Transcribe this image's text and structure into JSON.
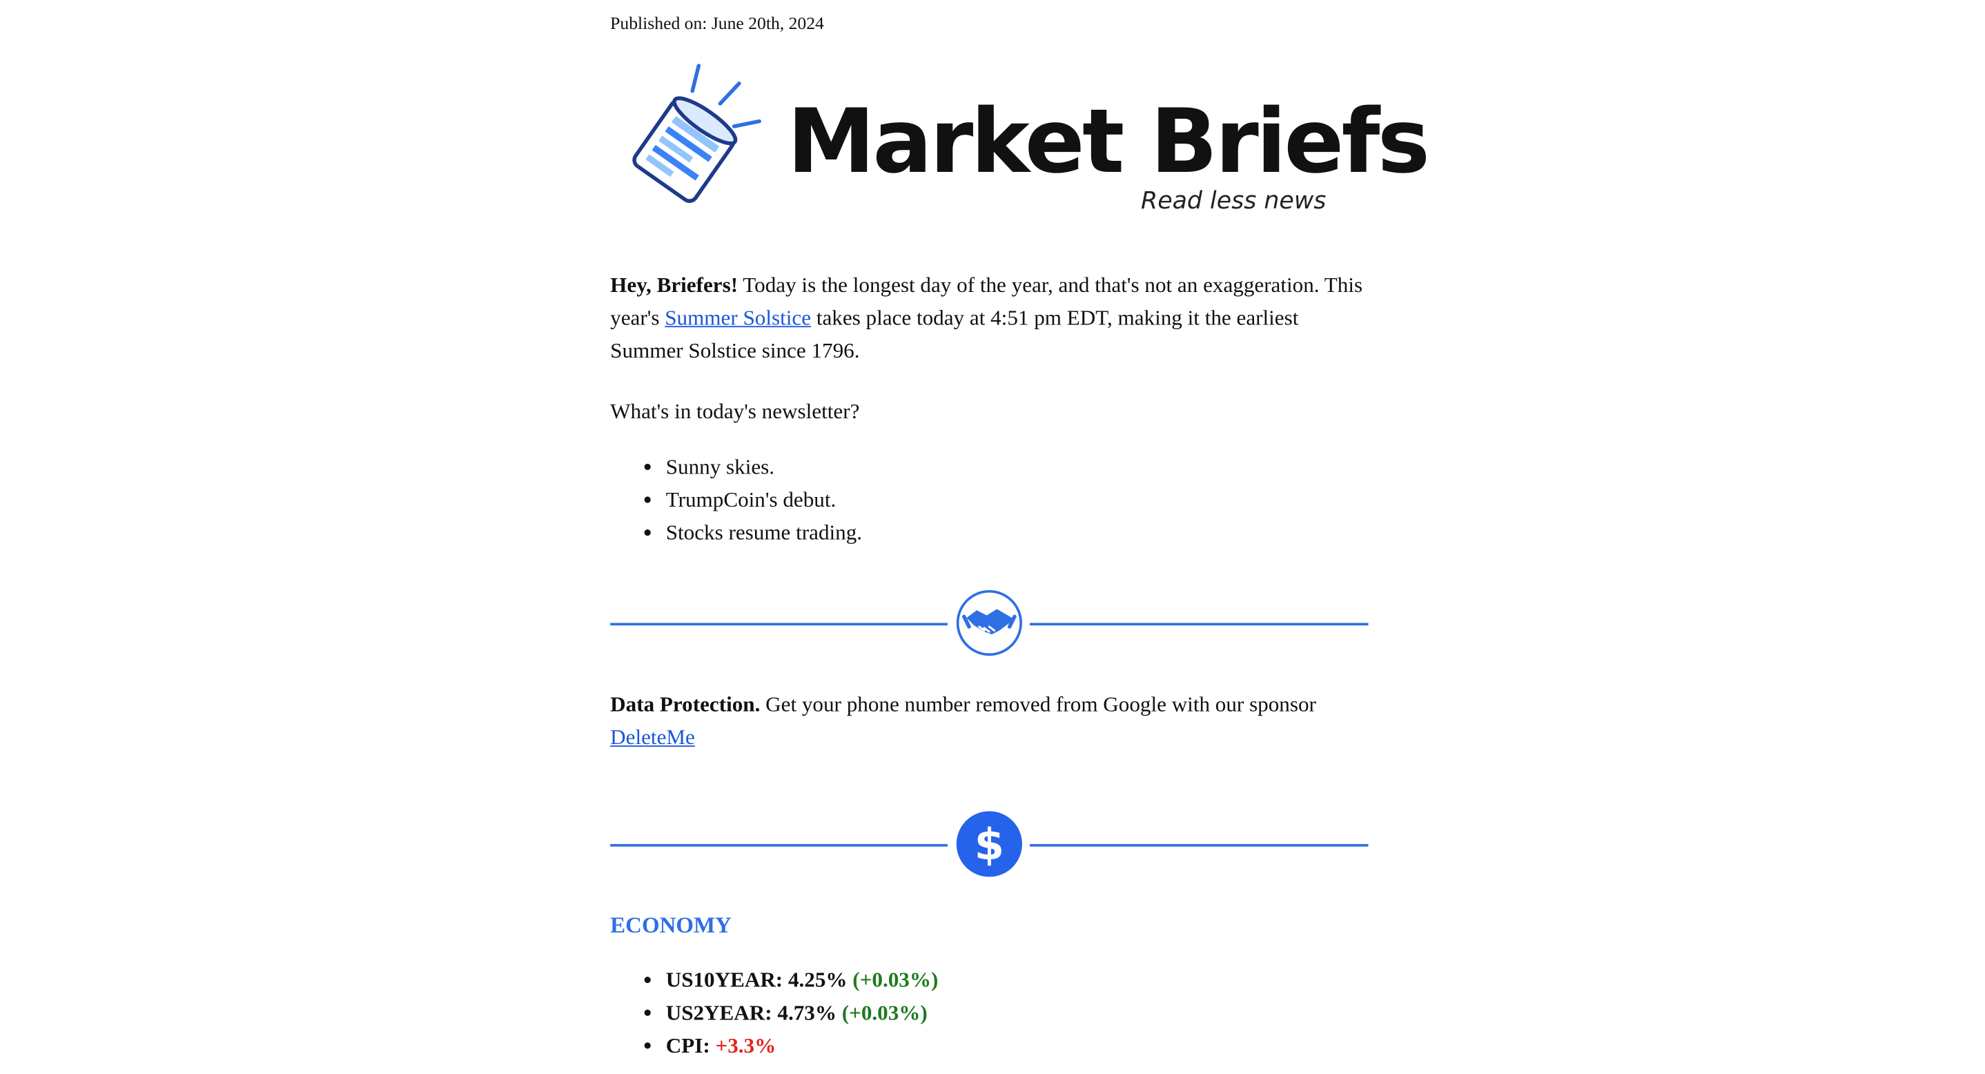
{
  "published": "Published on: June 20th, 2024",
  "logo": {
    "title": "Market Briefs",
    "tagline": "Read less news",
    "brand_color": "#2f6fe4",
    "icon": "newspaper-icon"
  },
  "intro": {
    "greeting": "Hey, Briefers!",
    "text_a": " Today is the longest day of the year, and that's not an exaggeration. This year's ",
    "link": "Summer Solstice",
    "text_b": " takes place today at 4:51 pm EDT, making it the earliest Summer Solstice since 1796."
  },
  "question": "What's in today's newsletter?",
  "highlights": [
    "Sunny skies.",
    "TrumpCoin's debut.",
    "Stocks resume trading."
  ],
  "dividers": [
    {
      "icon": "handshake-icon"
    },
    {
      "icon": "dollar-icon"
    }
  ],
  "sponsor": {
    "lead": "Data Protection.",
    "text": " Get your phone number removed from Google with our sponsor ",
    "link": "DeleteMe"
  },
  "economy": {
    "heading": "ECONOMY",
    "items": [
      {
        "label": "US10YEAR: 4.25%",
        "change": "(+0.03%)",
        "direction": "up"
      },
      {
        "label": "US2YEAR: 4.73%",
        "change": "(+0.03%)",
        "direction": "up"
      },
      {
        "label": "CPI:",
        "change": "+3.3%",
        "direction": "down"
      }
    ],
    "up_color": "#1f7a1f",
    "down_color": "#e3241b"
  }
}
